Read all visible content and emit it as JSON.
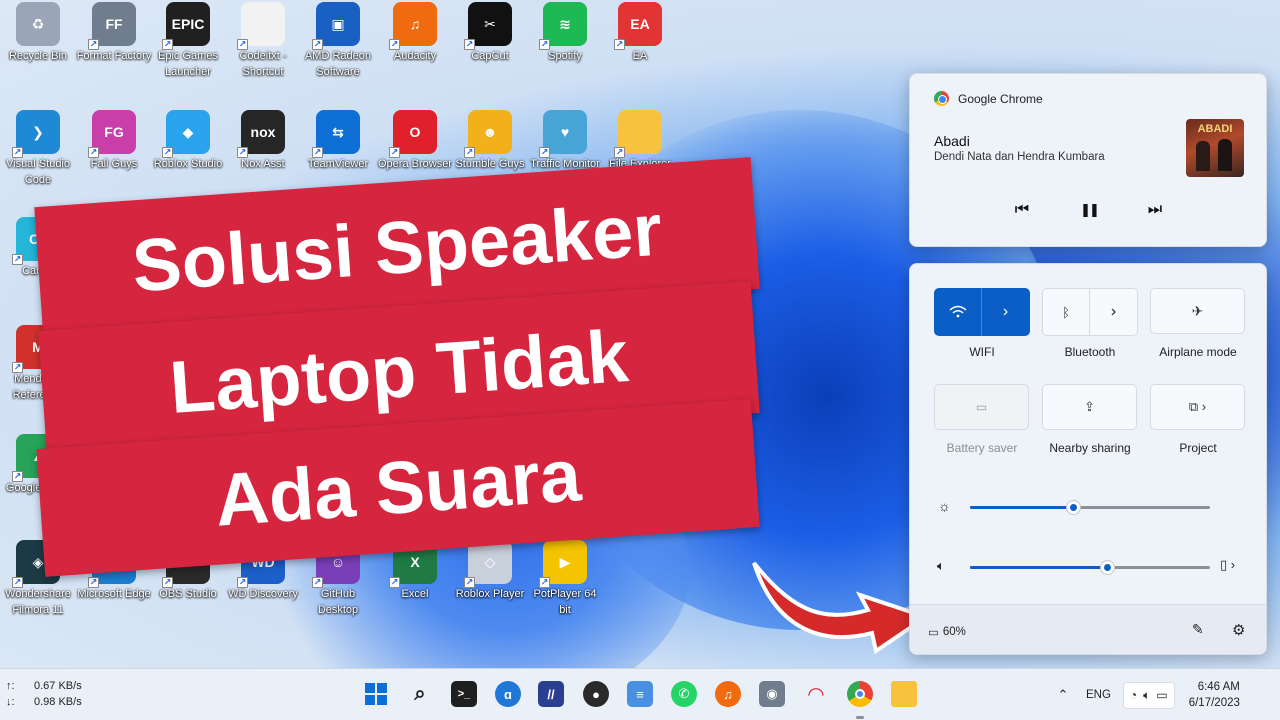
{
  "desktop": {
    "icons": [
      {
        "label": "Recycle Bin",
        "glyph": "♻",
        "color": "#9aa6b5"
      },
      {
        "label": "Format Factory",
        "glyph": "FF",
        "color": "#6f7d8f"
      },
      {
        "label": "Epic Games Launcher",
        "glyph": "EPIC",
        "color": "#202020"
      },
      {
        "label": "Codeitxt - Shortcut",
        "glyph": "",
        "color": "#f2f2f2"
      },
      {
        "label": "AMD Radeon Software",
        "glyph": "▣",
        "color": "#1a5fc2"
      },
      {
        "label": "Audacity",
        "glyph": "♫",
        "color": "#f06a10"
      },
      {
        "label": "CapCut",
        "glyph": "✂",
        "color": "#111"
      },
      {
        "label": "Spotify",
        "glyph": "≋",
        "color": "#1db954"
      },
      {
        "label": "EA",
        "glyph": "EA",
        "color": "#e23434"
      },
      {
        "label": "Visual Studio Code",
        "glyph": "❯",
        "color": "#1e8ad6"
      },
      {
        "label": "Fall Guys",
        "glyph": "FG",
        "color": "#c93ea9"
      },
      {
        "label": "Roblox Studio",
        "glyph": "◆",
        "color": "#29a3ec"
      },
      {
        "label": "Nox Asst",
        "glyph": "nox",
        "color": "#262626"
      },
      {
        "label": "TeamViewer",
        "glyph": "⇆",
        "color": "#0e6fd6"
      },
      {
        "label": "Opera Browser",
        "glyph": "O",
        "color": "#e0202a"
      },
      {
        "label": "Stumble Guys",
        "glyph": "☻",
        "color": "#f2b01a"
      },
      {
        "label": "Traffic Monitor",
        "glyph": "♥",
        "color": "#48a4d6"
      },
      {
        "label": "File Explorer",
        "glyph": "",
        "color": "#f7c33f"
      },
      {
        "label": "Canva",
        "glyph": "Ca",
        "color": "#24b6d9"
      },
      {
        "label": "Mendeley Reference",
        "glyph": "M",
        "color": "#d0312d"
      },
      {
        "label": "Google Drive",
        "glyph": "▲",
        "color": "#27a35a"
      },
      {
        "label": "Wondershare Filmora 11",
        "glyph": "◈",
        "color": "#1c3a44"
      },
      {
        "label": "Microsoft Edge",
        "glyph": "e",
        "color": "#1a7fd1"
      },
      {
        "label": "OBS Studio",
        "glyph": "●",
        "color": "#2a2a2a"
      },
      {
        "label": "WD Discovery",
        "glyph": "WD",
        "color": "#1c5fc8"
      },
      {
        "label": "GitHub Desktop",
        "glyph": "☺",
        "color": "#7a3fb8"
      },
      {
        "label": "Excel",
        "glyph": "X",
        "color": "#1f7a44"
      },
      {
        "label": "Roblox Player",
        "glyph": "◇",
        "color": "#c8d0dc"
      },
      {
        "label": "PotPlayer 64 bit",
        "glyph": "▶",
        "color": "#f4c400"
      }
    ]
  },
  "banner": {
    "line1": "Solusi Speaker",
    "line2": "Laptop Tidak",
    "line3": "Ada Suara",
    "color": "#d6253f"
  },
  "media": {
    "app": "Google Chrome",
    "title": "Abadi",
    "artist": "Dendi Nata dan Hendra Kumbara",
    "album_text": "ABADI",
    "prev_icon": "⏮",
    "pause_icon": "❚❚",
    "next_icon": "⏭"
  },
  "quick": {
    "wifi_label": "WIFI",
    "bluetooth_label": "Bluetooth",
    "airplane_label": "Airplane mode",
    "battery_saver_label": "Battery saver",
    "nearby_label": "Nearby sharing",
    "project_label": "Project",
    "brightness_level": 0.43,
    "volume_level": 0.57,
    "battery_text": "60%",
    "accent": "#0a5ec6"
  },
  "taskbar": {
    "upload_speed": "0.67 KB/s",
    "download_speed": "0.98 KB/s",
    "lang": "ENG",
    "time": "6:46 AM",
    "date": "6/17/2023"
  }
}
